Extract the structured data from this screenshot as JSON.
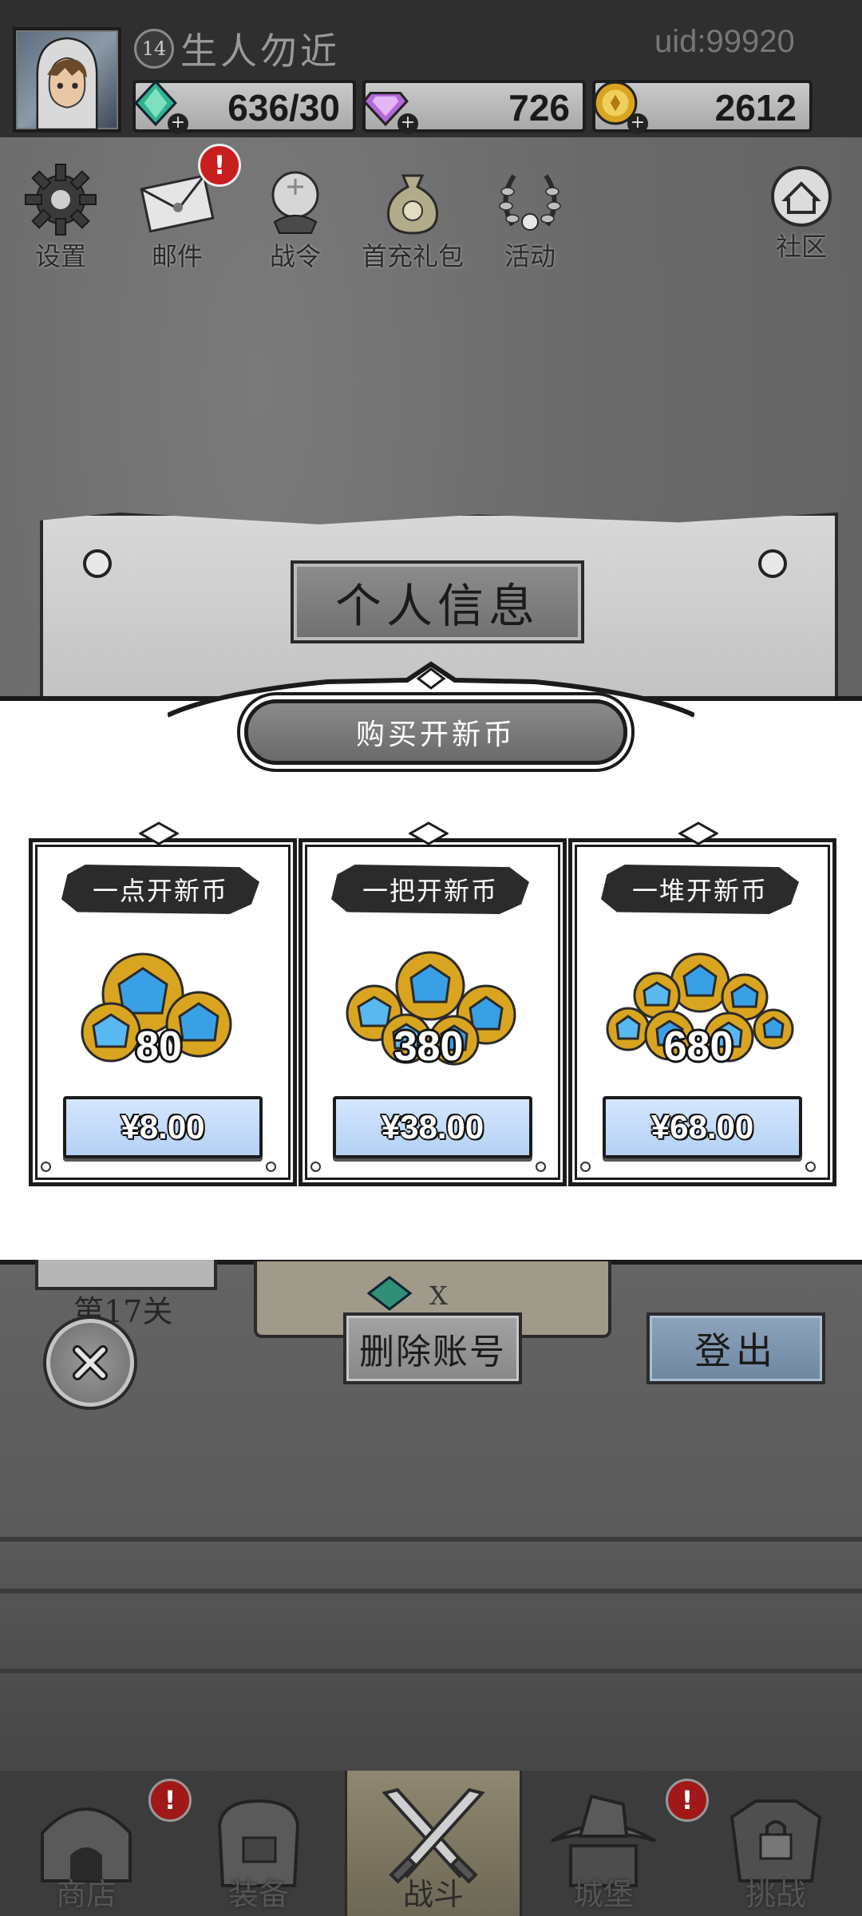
{
  "player": {
    "level": "14",
    "name": "生人勿近",
    "uid": "uid:99920"
  },
  "resources": [
    {
      "name": "stamina",
      "value": "636/30",
      "icon": "green-gem-icon",
      "color": "#2fb38f"
    },
    {
      "name": "gems",
      "value": "726",
      "icon": "purple-gem-icon",
      "color": "#b26ad6"
    },
    {
      "name": "gold",
      "value": "2612",
      "icon": "gold-coin-icon",
      "color": "#d9a520"
    }
  ],
  "menu": {
    "settings": "设置",
    "mail": "邮件",
    "battle_pass": "战令",
    "first_recharge": "首充礼包",
    "events": "活动",
    "community": "社区",
    "alert_mark": "!"
  },
  "profile": {
    "title": "个人信息",
    "stage": "第17关",
    "reward_multiplier": "X"
  },
  "purchase": {
    "title": "购买开新币",
    "packs": [
      {
        "name": "一点开新币",
        "amount": "80",
        "price": "¥8.00"
      },
      {
        "name": "一把开新币",
        "amount": "380",
        "price": "¥38.00"
      },
      {
        "name": "一堆开新币",
        "amount": "680",
        "price": "¥68.00"
      }
    ]
  },
  "actions": {
    "delete_account": "删除账号",
    "logout": "登出"
  },
  "nav": {
    "shop": "商店",
    "equipment": "装备",
    "battle": "战斗",
    "castle": "城堡",
    "challenge": "挑战"
  },
  "colors": {
    "price_button": "#c4dcf8",
    "logout_button": "#7f95ae",
    "alert": "#c81e1e",
    "gem_blue": "#3aa0e6",
    "coin_gold": "#d9a520"
  }
}
